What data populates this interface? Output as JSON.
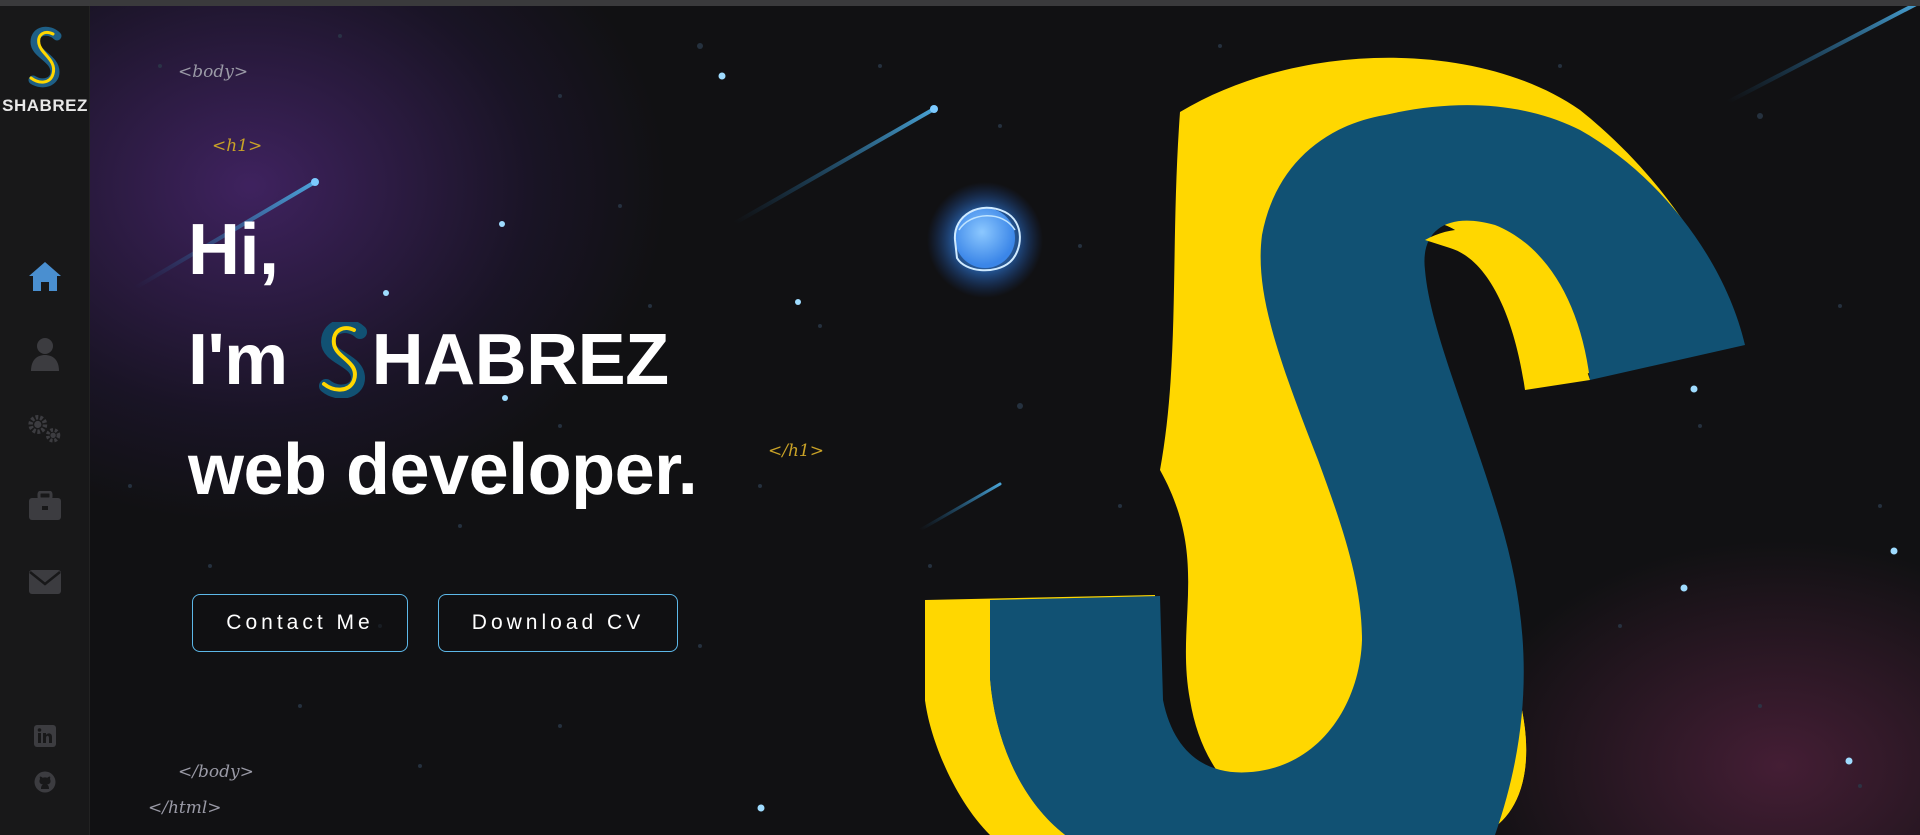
{
  "brand": {
    "name": "SHABREZ"
  },
  "nav": {
    "items": [
      {
        "icon": "home-icon",
        "label": "Home",
        "active": true
      },
      {
        "icon": "user-icon",
        "label": "About"
      },
      {
        "icon": "gears-icon",
        "label": "Skills"
      },
      {
        "icon": "briefcase-icon",
        "label": "Work"
      },
      {
        "icon": "envelope-icon",
        "label": "Contact"
      }
    ],
    "social": [
      {
        "icon": "linkedin-icon"
      },
      {
        "icon": "github-icon"
      }
    ]
  },
  "code_tags": {
    "body_open": "<body>",
    "h1_open": "<h1>",
    "h1_close": "</h1>",
    "body_close": "</body>",
    "html_close": "</html>"
  },
  "hero": {
    "line1": "Hi,",
    "line2_prefix": "I'm",
    "line2_name_rest": "HABREZ",
    "line3": "web developer."
  },
  "buttons": {
    "contact": "Contact Me",
    "download": "Download CV"
  },
  "colors": {
    "accent_blue": "#5db8e8",
    "brand_yellow": "#ffd700",
    "brand_teal": "#115173",
    "background": "#111113",
    "icon_active": "#4a8fd0",
    "icon_inactive": "#3c3c40"
  }
}
